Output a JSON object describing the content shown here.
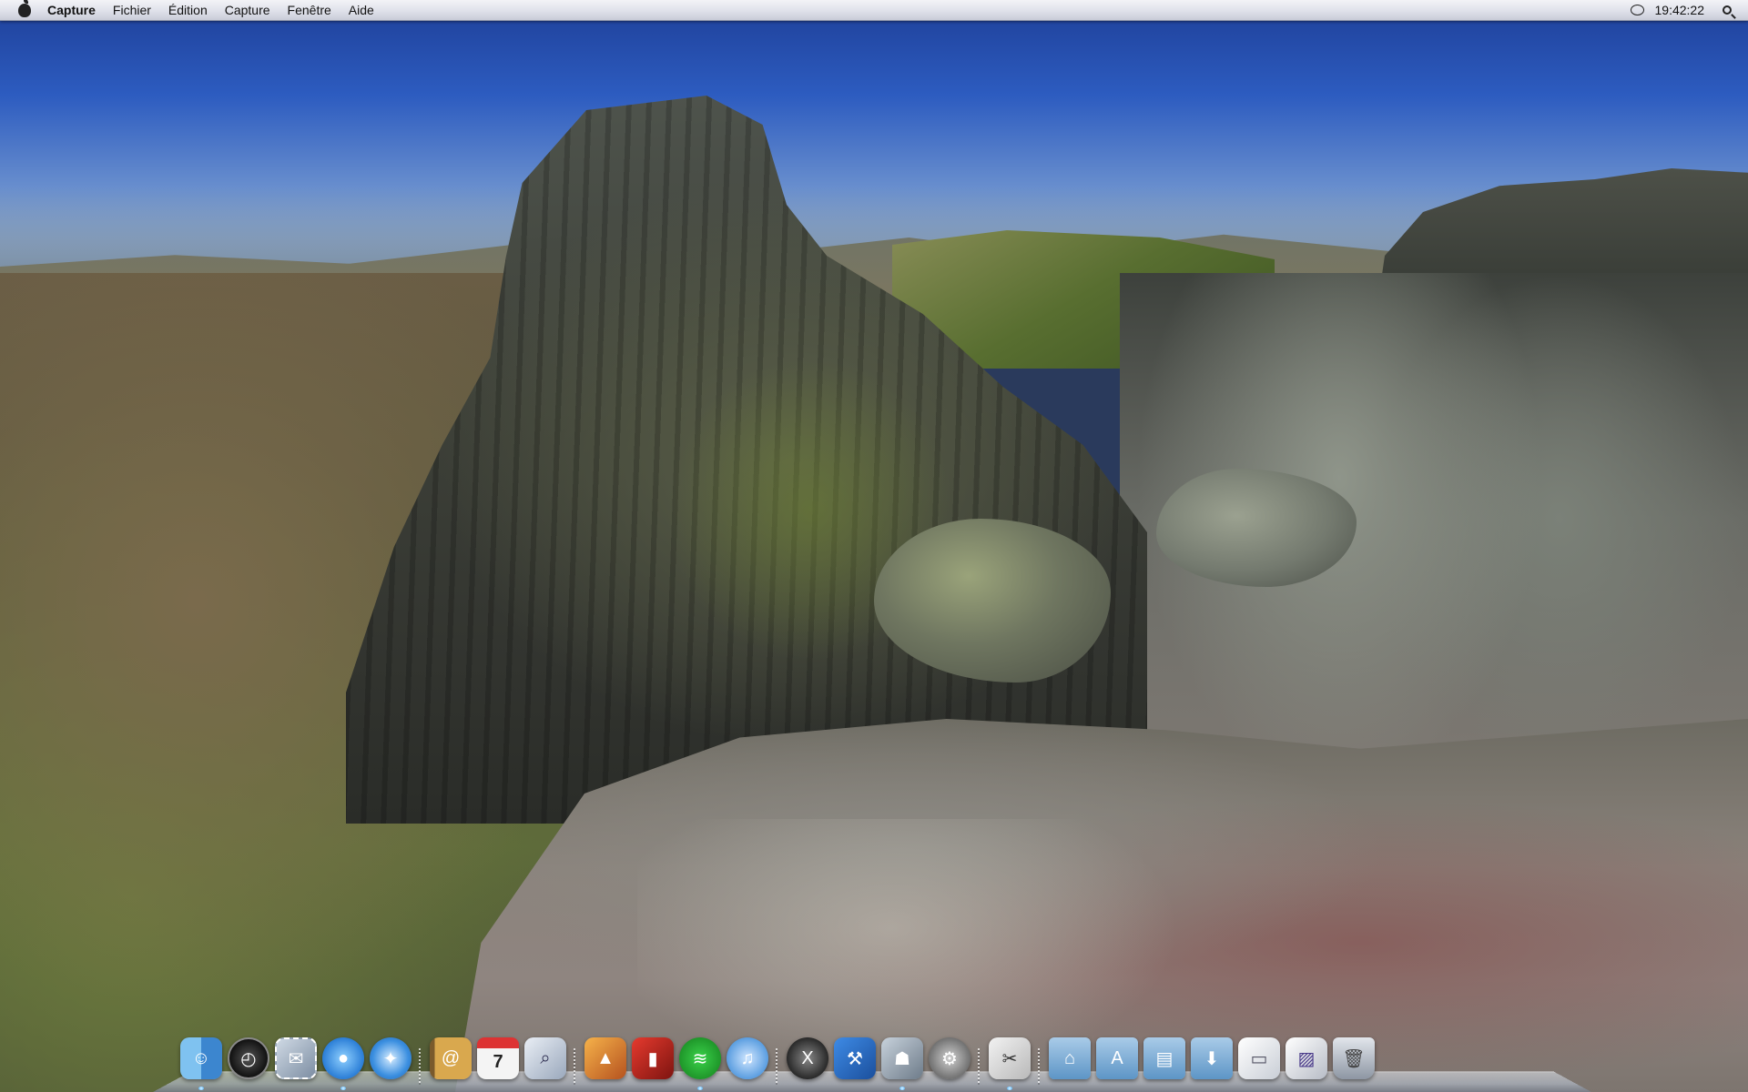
{
  "menubar": {
    "app_name": "Capture",
    "menus": [
      "Fichier",
      "Édition",
      "Capture",
      "Fenêtre",
      "Aide"
    ],
    "clock": "19:42:22"
  },
  "dock": {
    "calendar_day": "7",
    "icons": [
      "finder-icon",
      "dashboard-icon",
      "mail-stamp-icon",
      "facetime-icon",
      "safari-icon",
      "address-book-icon",
      "calendar-icon",
      "preview-icon",
      "iphoto-icon",
      "photo-booth-icon",
      "spotify-icon",
      "itunes-icon",
      "osx-x-icon",
      "xcode-icon",
      "automator-icon",
      "system-preferences-icon",
      "grapher-icon",
      "applications-folder-icon",
      "app-store-folder-icon",
      "documents-folder-icon",
      "downloads-folder-icon",
      "screenshot-stack-icon",
      "screenshot-stack-2-icon",
      "trash-icon"
    ]
  }
}
